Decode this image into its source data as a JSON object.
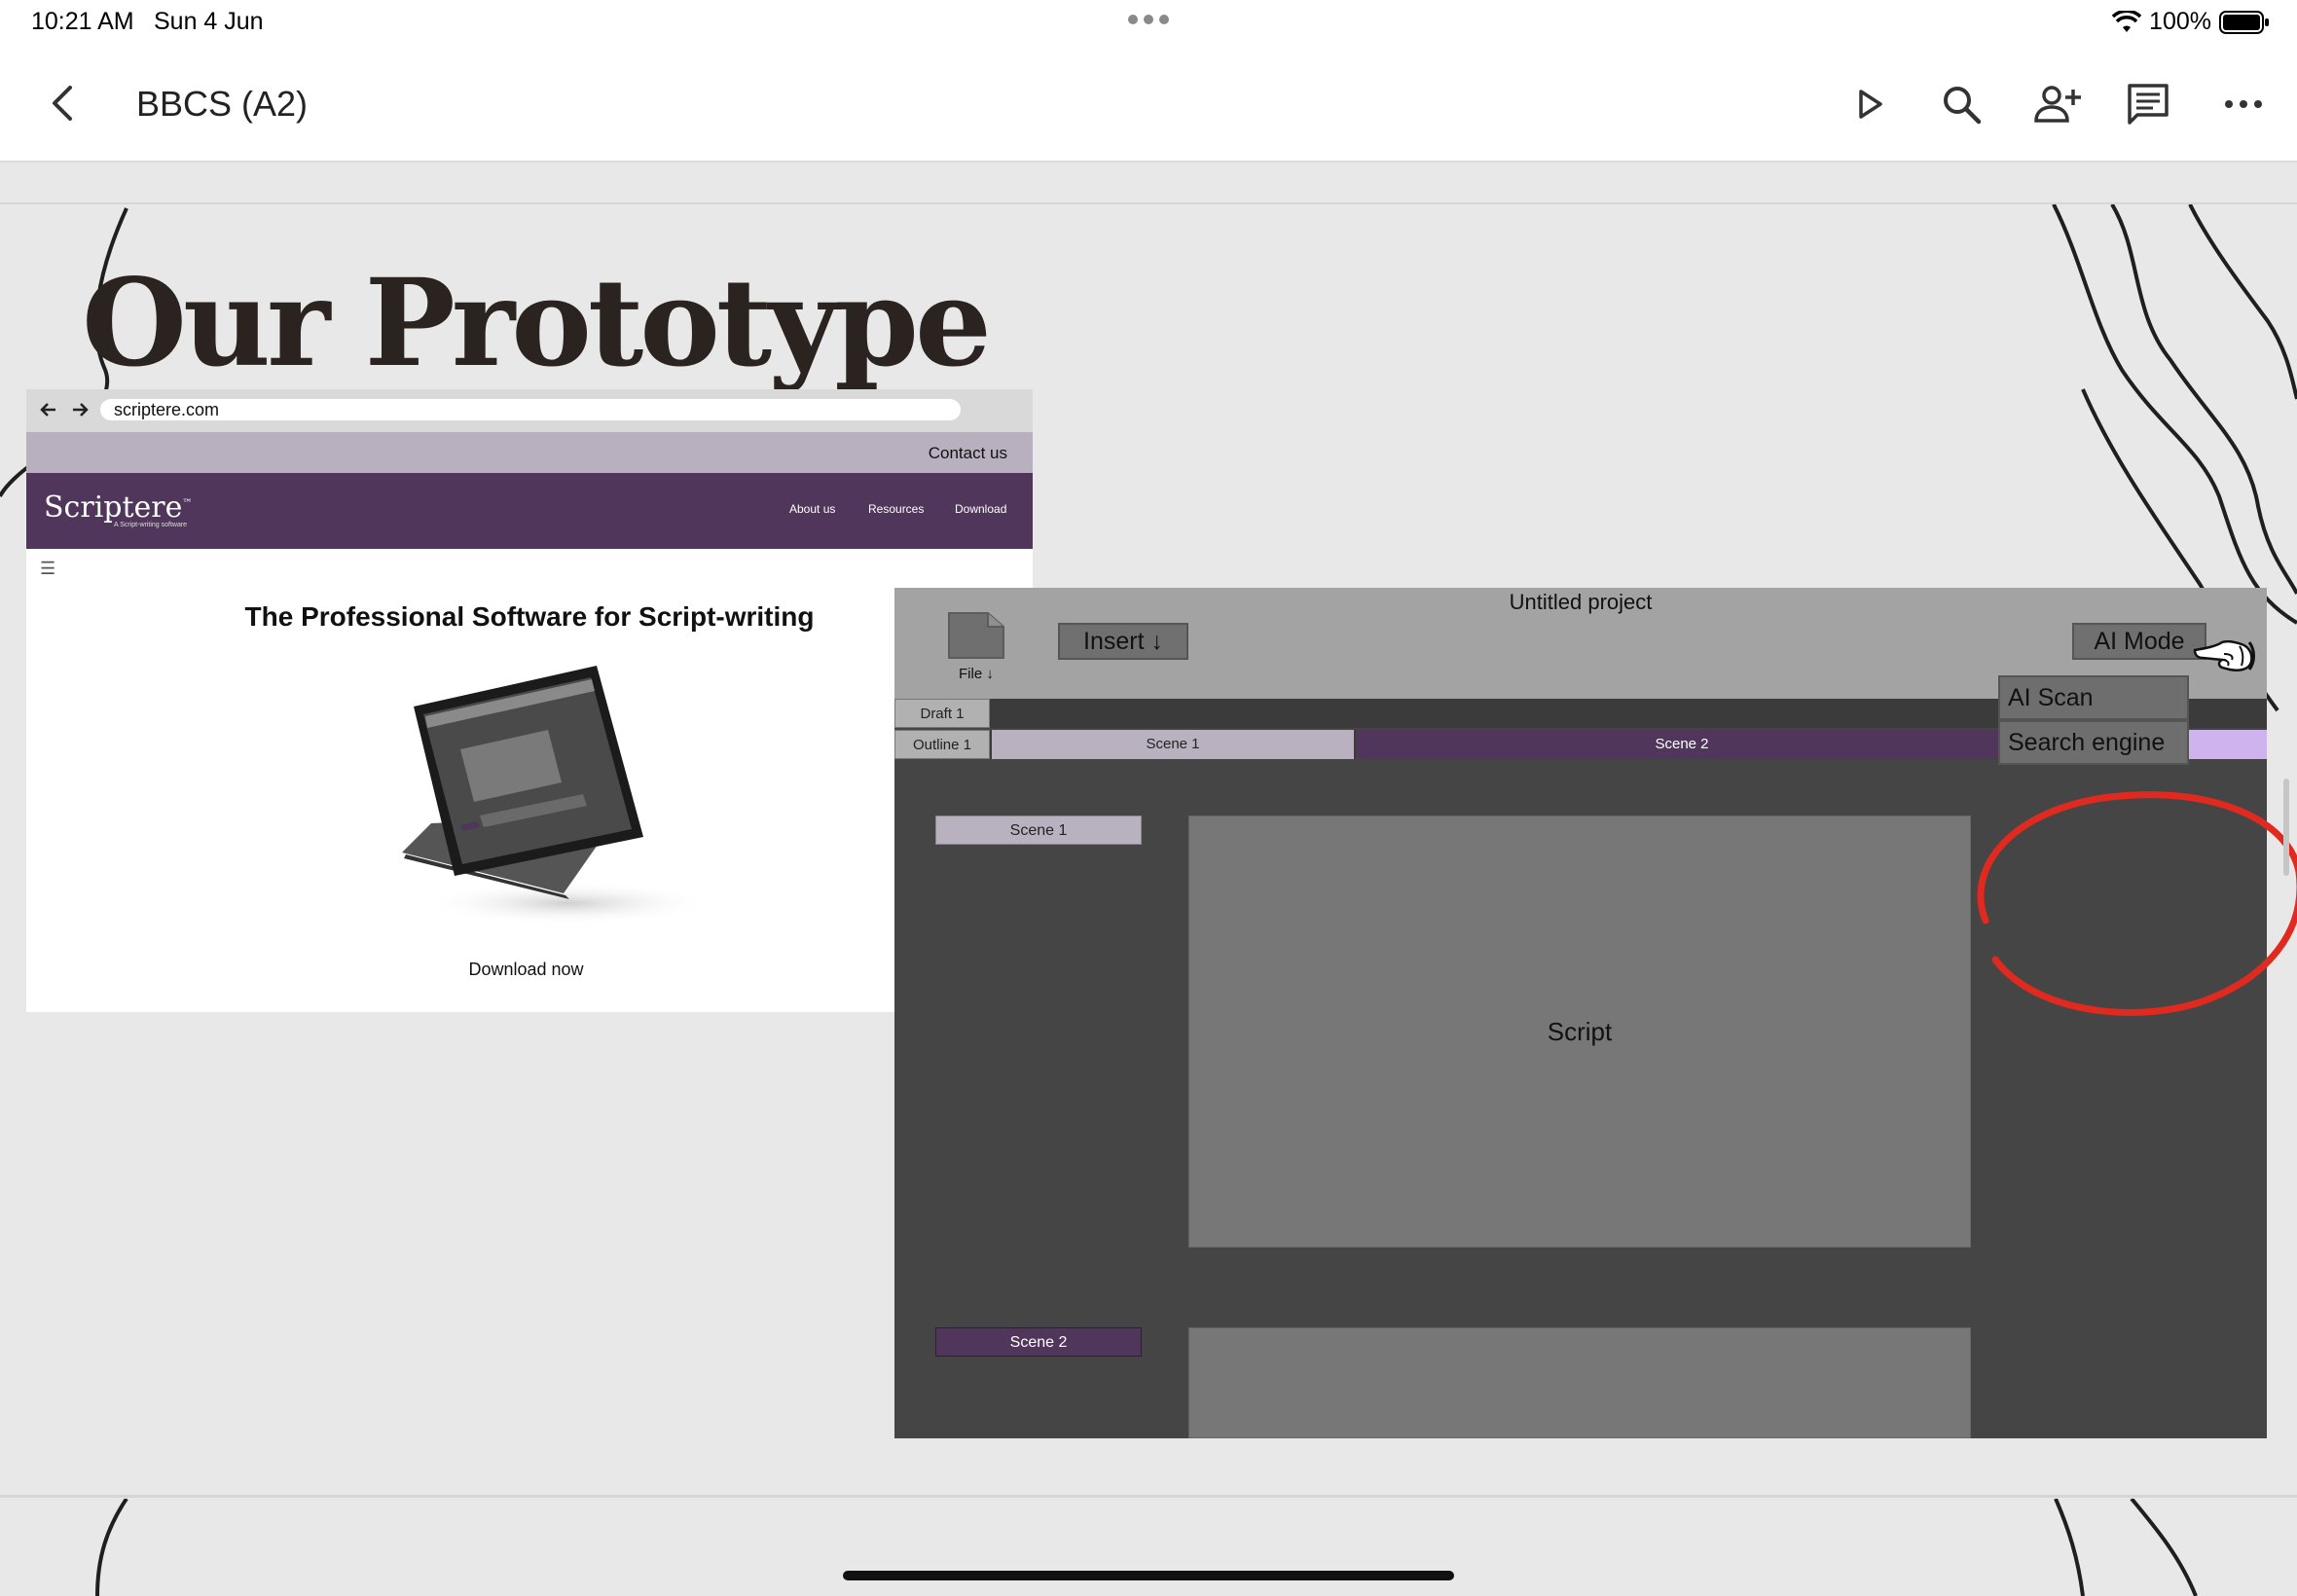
{
  "status_bar": {
    "time": "10:21 AM",
    "date": "Sun 4 Jun",
    "battery": "100%"
  },
  "toolbar": {
    "document_title": "BBCS (A2)",
    "icons": [
      "back-icon",
      "play-icon",
      "search-icon",
      "add-person-icon",
      "comment-icon",
      "more-icon"
    ]
  },
  "slide": {
    "title": "Our Prototype",
    "website": {
      "url": "scriptere.com",
      "contact": "Contact us",
      "logo": "Scriptere",
      "logo_mark": "™",
      "tagline": "A Script-writing software",
      "nav": [
        "About us",
        "Resources",
        "Download"
      ],
      "headline": "The Professional Software for Script-writing",
      "cta": "Download now",
      "brand_color": "#51365c"
    },
    "app": {
      "project_title": "Untitled project",
      "file_label": "File ↓",
      "insert_label": "Insert ↓",
      "ai_mode_label": "AI Mode",
      "ai_menu": [
        "AI Scan",
        "Search engine"
      ],
      "draft_tab": "Draft 1",
      "outline_tab": "Outline 1",
      "scene_tabs": [
        "Scene 1",
        "Scene 2"
      ],
      "scene_labels": [
        "Scene 1",
        "Scene 2"
      ],
      "script_placeholder": "Script",
      "highlight_color": "#e02a1f"
    }
  }
}
